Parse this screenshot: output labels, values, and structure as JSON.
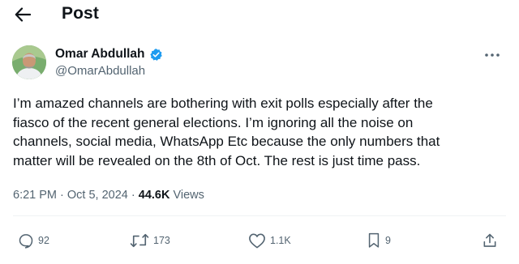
{
  "header": {
    "title": "Post",
    "back_icon": "arrow-left-icon"
  },
  "author": {
    "name": "Omar Abdullah",
    "handle": "@OmarAbdullah",
    "verified_icon": "verified-badge-icon",
    "verified_color": "#1d9bf0"
  },
  "tweet": {
    "lines": [
      "I’m amazed channels are bothering with exit polls especially after the",
      "fiasco of the recent general elections. I’m ignoring all the noise on",
      "channels, social media, WhatsApp Etc because the only numbers that",
      "matter will be revealed on the 8th of Oct. The rest is just time pass."
    ]
  },
  "meta": {
    "time": "6:21 PM",
    "separator": " · ",
    "date": "Oct 5, 2024",
    "views_count": "44.6K",
    "views_label": "Views"
  },
  "actions": {
    "replies": {
      "icon": "reply-icon",
      "count": "92"
    },
    "reposts": {
      "icon": "repost-icon",
      "count": "173"
    },
    "likes": {
      "icon": "heart-icon",
      "count": "1.1K"
    },
    "bookmarks": {
      "icon": "bookmark-icon",
      "count": "9"
    },
    "share": {
      "icon": "share-icon"
    }
  },
  "colors": {
    "text_primary": "#0f1419",
    "text_secondary": "#536471",
    "accent": "#1d9bf0",
    "divider": "#eff3f4"
  }
}
